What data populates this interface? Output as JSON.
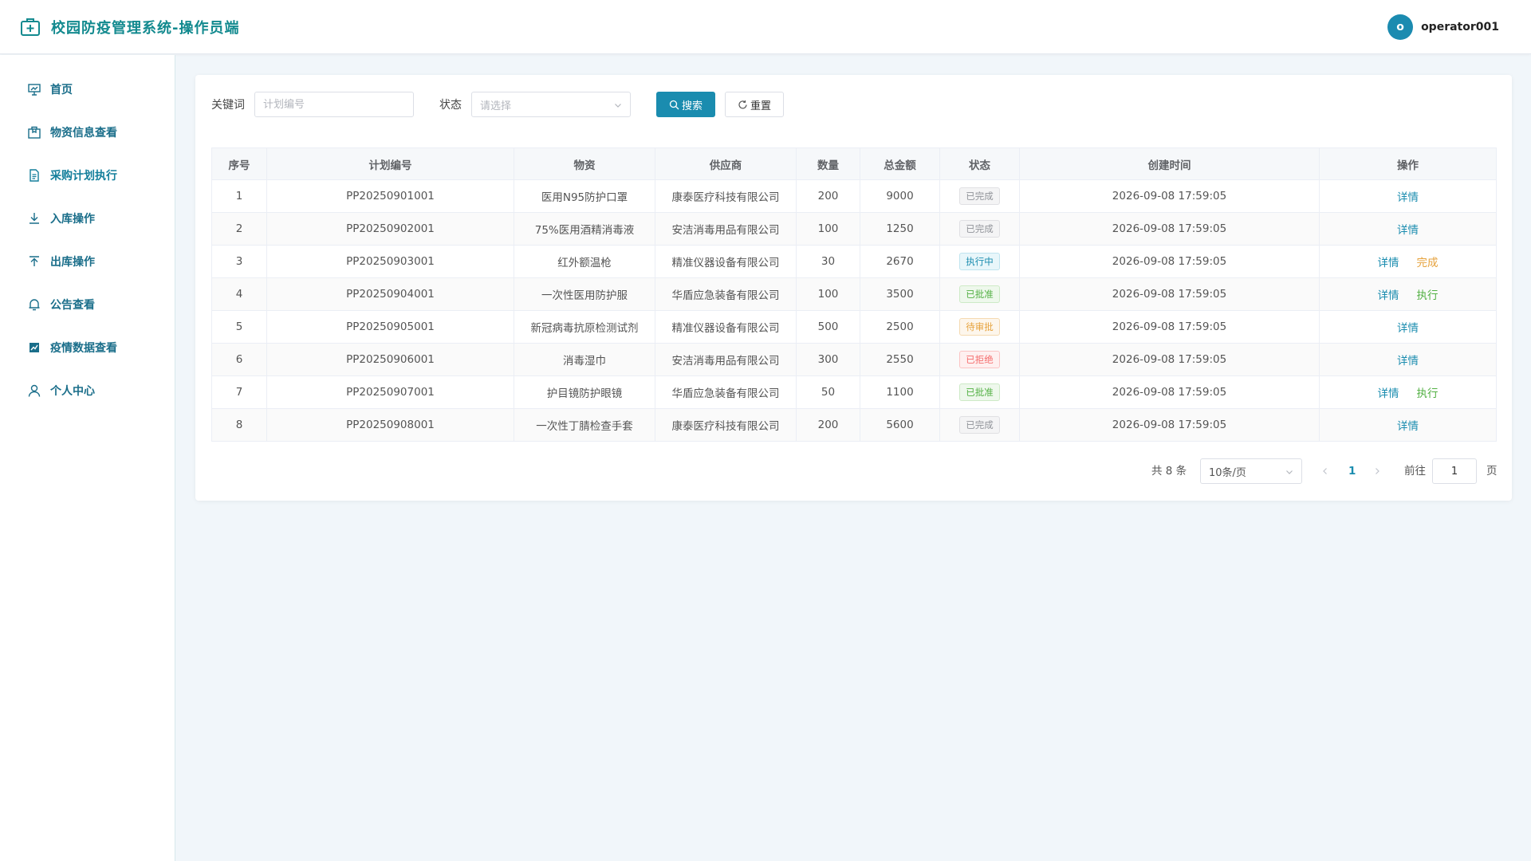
{
  "header": {
    "title": "校园防疫管理系统-操作员端",
    "avatar_letter": "o",
    "username": "operator001"
  },
  "colors": {
    "brand": "#138a8f",
    "primary": "#1a8caf",
    "link": "#1a8caf"
  },
  "sidebar": {
    "items": [
      {
        "label": "首页",
        "icon": "dashboard-board-icon"
      },
      {
        "label": "物资信息查看",
        "icon": "package-icon"
      },
      {
        "label": "采购计划执行",
        "icon": "document-icon"
      },
      {
        "label": "入库操作",
        "icon": "download-icon"
      },
      {
        "label": "出库操作",
        "icon": "upload-icon"
      },
      {
        "label": "公告查看",
        "icon": "bell-icon"
      },
      {
        "label": "疫情数据查看",
        "icon": "chart-icon"
      },
      {
        "label": "个人中心",
        "icon": "user-icon"
      }
    ]
  },
  "search": {
    "keyword_label": "关键词",
    "keyword_placeholder": "计划编号",
    "keyword_value": "",
    "status_label": "状态",
    "status_placeholder": "请选择",
    "search_button": "搜索",
    "reset_button": "重置"
  },
  "table": {
    "columns": [
      "序号",
      "计划编号",
      "物资",
      "供应商",
      "数量",
      "总金额",
      "状态",
      "创建时间",
      "操作"
    ],
    "rows": [
      {
        "no": "1",
        "plan_no": "PP20250901001",
        "material": "医用N95防护口罩",
        "supplier": "康泰医疗科技有限公司",
        "qty": "200",
        "amount": "9000",
        "status": "已完成",
        "status_kind": "done",
        "created": "2026-09-08 17:59:05",
        "actions": [
          "详情"
        ]
      },
      {
        "no": "2",
        "plan_no": "PP20250902001",
        "material": "75%医用酒精消毒液",
        "supplier": "安洁消毒用品有限公司",
        "qty": "100",
        "amount": "1250",
        "status": "已完成",
        "status_kind": "done",
        "created": "2026-09-08 17:59:05",
        "actions": [
          "详情"
        ]
      },
      {
        "no": "3",
        "plan_no": "PP20250903001",
        "material": "红外额温枪",
        "supplier": "精准仪器设备有限公司",
        "qty": "30",
        "amount": "2670",
        "status": "执行中",
        "status_kind": "running",
        "created": "2026-09-08 17:59:05",
        "actions": [
          "详情",
          "完成"
        ]
      },
      {
        "no": "4",
        "plan_no": "PP20250904001",
        "material": "一次性医用防护服",
        "supplier": "华盾应急装备有限公司",
        "qty": "100",
        "amount": "3500",
        "status": "已批准",
        "status_kind": "approved",
        "created": "2026-09-08 17:59:05",
        "actions": [
          "详情",
          "执行"
        ]
      },
      {
        "no": "5",
        "plan_no": "PP20250905001",
        "material": "新冠病毒抗原检测试剂",
        "supplier": "精准仪器设备有限公司",
        "qty": "500",
        "amount": "2500",
        "status": "待审批",
        "status_kind": "pending",
        "created": "2026-09-08 17:59:05",
        "actions": [
          "详情"
        ]
      },
      {
        "no": "6",
        "plan_no": "PP20250906001",
        "material": "消毒湿巾",
        "supplier": "安洁消毒用品有限公司",
        "qty": "300",
        "amount": "2550",
        "status": "已拒绝",
        "status_kind": "rejected",
        "created": "2026-09-08 17:59:05",
        "actions": [
          "详情"
        ]
      },
      {
        "no": "7",
        "plan_no": "PP20250907001",
        "material": "护目镜防护眼镜",
        "supplier": "华盾应急装备有限公司",
        "qty": "50",
        "amount": "1100",
        "status": "已批准",
        "status_kind": "approved",
        "created": "2026-09-08 17:59:05",
        "actions": [
          "详情",
          "执行"
        ]
      },
      {
        "no": "8",
        "plan_no": "PP20250908001",
        "material": "一次性丁腈检查手套",
        "supplier": "康泰医疗科技有限公司",
        "qty": "200",
        "amount": "5600",
        "status": "已完成",
        "status_kind": "done",
        "created": "2026-09-08 17:59:05",
        "actions": [
          "详情"
        ]
      }
    ]
  },
  "pagination": {
    "total_text": "共 8 条",
    "page_size": "10条/页",
    "current_page": "1",
    "goto_label": "前往",
    "goto_value": "1",
    "page_suffix": "页"
  }
}
